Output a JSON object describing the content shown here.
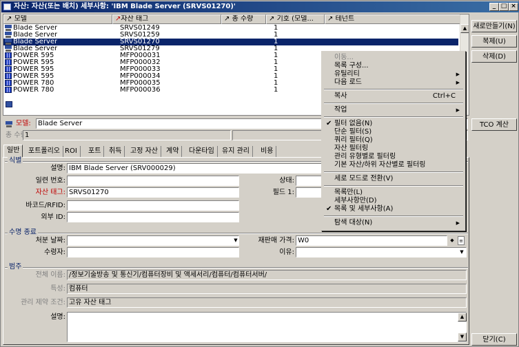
{
  "window": {
    "title": "자산: 자산(또는 배치) 세부사항: 'IBM Blade Server (SRVS01270)'"
  },
  "list": {
    "columns": [
      "모델",
      "자산 태그",
      "총 수량",
      "기호 (모델...",
      "테넌트"
    ],
    "rows": [
      {
        "icon": "blade-server-icon",
        "model": "Blade Server",
        "tag": "SRVS01249",
        "qty": "1",
        "selected": false
      },
      {
        "icon": "blade-server-icon",
        "model": "Blade Server",
        "tag": "SRVS01259",
        "qty": "1",
        "selected": false
      },
      {
        "icon": "blade-server-icon",
        "model": "Blade Server",
        "tag": "SRVS01270",
        "qty": "1",
        "selected": true
      },
      {
        "icon": "blade-server-icon",
        "model": "Blade Server",
        "tag": "SRVS01279",
        "qty": "1",
        "selected": false
      },
      {
        "icon": "power-server-icon",
        "model": "POWER 595",
        "tag": "MFP000031",
        "qty": "1",
        "selected": false
      },
      {
        "icon": "power-server-icon",
        "model": "POWER 595",
        "tag": "MFP000032",
        "qty": "1",
        "selected": false
      },
      {
        "icon": "power-server-icon",
        "model": "POWER 595",
        "tag": "MFP000033",
        "qty": "1",
        "selected": false
      },
      {
        "icon": "power-server-icon",
        "model": "POWER 595",
        "tag": "MFP000034",
        "qty": "1",
        "selected": false
      },
      {
        "icon": "power-server-icon",
        "model": "POWER 780",
        "tag": "MFP000035",
        "qty": "1",
        "selected": false
      },
      {
        "icon": "power-server-icon",
        "model": "POWER 780",
        "tag": "MFP000036",
        "qty": "1",
        "selected": false
      }
    ]
  },
  "side_buttons": {
    "new": "새로만들기(N)",
    "copy": "복제(U)",
    "delete": "삭제(D)",
    "tco": "TCO 계산",
    "close": "닫기(C)"
  },
  "context_menu": {
    "items": [
      {
        "label": "이동...",
        "disabled": true
      },
      {
        "label": "목록 구성..."
      },
      {
        "label": "유틸리티",
        "submenu": true
      },
      {
        "label": "다음 로드",
        "submenu": true
      },
      {
        "sep": true
      },
      {
        "label": "복사",
        "shortcut": "Ctrl+C"
      },
      {
        "sep": true
      },
      {
        "label": "작업",
        "submenu": true
      },
      {
        "sep": true
      },
      {
        "label": "필터 없음(N)",
        "checked": true
      },
      {
        "label": "단순 필터(S)"
      },
      {
        "label": "쿼리 필터(Q)"
      },
      {
        "label": "자산 필터링"
      },
      {
        "label": "관리 유형별로 필터링"
      },
      {
        "label": "기본 자산/하위 자산별로 필터링"
      },
      {
        "sep": true
      },
      {
        "label": "세로 모드로 전환(V)"
      },
      {
        "sep": true
      },
      {
        "label": "목록만(L)"
      },
      {
        "label": "세부사항만(D)"
      },
      {
        "label": "목록 및 세부사항(A)",
        "checked": true
      },
      {
        "sep": true
      },
      {
        "label": "탐색 대상(N)",
        "submenu": true
      }
    ]
  },
  "detail": {
    "model_label": "모델:",
    "model_value": "Blade Server",
    "qty_label": "총 수량:",
    "qty_value": "1",
    "tabs": [
      "일반",
      "포트폴리오",
      "ROI",
      "포트",
      "취득",
      "고정 자산",
      "계약",
      "다운타임",
      "유지 관리",
      "비용"
    ],
    "groups": {
      "id": "식별",
      "life": "수명 종료",
      "category": "범주"
    },
    "fields": {
      "desc_label": "설명:",
      "desc_value": "IBM Blade Server (SRV000029)",
      "serial_label": "일련 번호:",
      "serial_value": "",
      "status_label": "상태:",
      "status_value": "",
      "tag_label": "자산 태그:",
      "tag_value": "SRVS01270",
      "field1_label": "필드 1:",
      "field1_value": "",
      "barcode_label": "바코드/RFID:",
      "barcode_value": "",
      "extid_label": "외부 ID:",
      "extid_value": "",
      "disposal_label": "처분 날짜:",
      "disposal_value": "",
      "resale_label": "재판매 가격:",
      "resale_value": "W0",
      "recipient_label": "수령자:",
      "recipient_value": "",
      "reason_label": "이유:",
      "reason_value": "",
      "fullname_label": "전체 이름:",
      "fullname_value": "/정보기술방송 및 통신기/컴퓨터장비 및 액세서리/컴퓨터/컴퓨터서버/",
      "feature_label": "특성:",
      "feature_value": "컴퓨터",
      "constraint_label": "관리 제약 조건:",
      "constraint_value": "고유 자산 태그",
      "notes_label": "설명:",
      "notes_value": ""
    }
  }
}
